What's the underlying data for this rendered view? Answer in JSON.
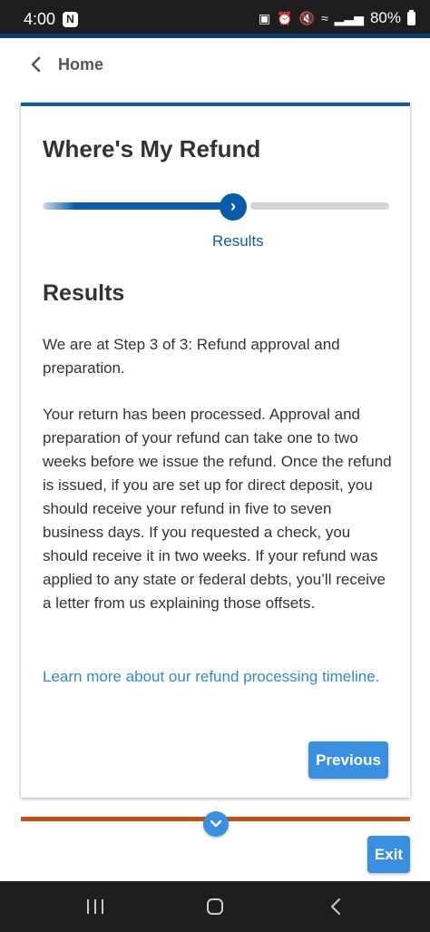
{
  "status_bar": {
    "time": "4:00",
    "battery": "80%"
  },
  "header": {
    "back_label": "Home"
  },
  "card": {
    "title": "Where's My Refund",
    "progress": {
      "current_step": 3,
      "total_steps": 3,
      "fill_fraction": 0.55,
      "step_label": "Results"
    },
    "section_title": "Results",
    "paragraph_1": "We are at Step 3 of 3: Refund approval and preparation.",
    "paragraph_2": "Your return has been processed. Approval and preparation of your refund can take one to two weeks before we issue the refund. Once the refund is issued, if you are set up for direct deposit, you should receive your refund in five to seven business days. If you requested a check, you should receive it in two weeks. If your refund was applied to any state or federal debts, you’ll receive a letter from us explaining those offsets.",
    "learn_more_link": "Learn more about our refund processing timeline.",
    "previous_button": "Previous"
  },
  "exit_button": "Exit",
  "colors": {
    "primary_blue": "#0b5ca8",
    "button_blue": "#3a8fe0",
    "link_blue": "#2f8ad0",
    "accent_orange": "#b85418"
  },
  "icons": {
    "back": "chevron-left-icon",
    "progress_knob": "chevron-right-icon",
    "scroll_down": "chevron-down-icon"
  }
}
